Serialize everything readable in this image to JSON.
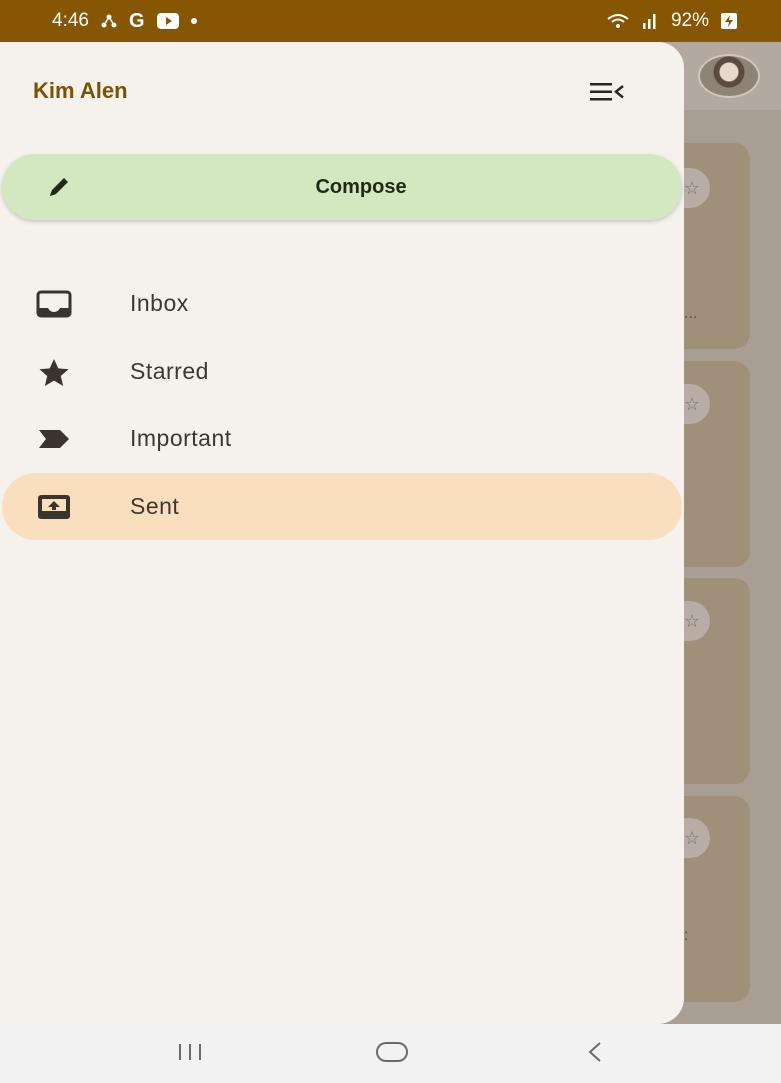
{
  "status_bar": {
    "time": "4:46",
    "battery": "92%",
    "icons": [
      "tree-icon",
      "google-icon",
      "youtube-icon",
      "dot-icon",
      "wifi-icon",
      "signal-icon",
      "battery-charging-icon"
    ],
    "google_glyph": "G"
  },
  "drawer": {
    "account_name": "Kim Alen",
    "compose_label": "Compose",
    "nav_items": [
      {
        "label": "Inbox",
        "icon": "inbox-icon",
        "active": false
      },
      {
        "label": "Starred",
        "icon": "star-icon",
        "active": false
      },
      {
        "label": "Important",
        "icon": "important-icon",
        "active": false
      },
      {
        "label": "Sent",
        "icon": "sent-icon",
        "active": true
      }
    ]
  },
  "background": {
    "dots": [
      "...",
      ":"
    ]
  },
  "colors": {
    "status_bar": "#875603",
    "accent_text": "#7c5200",
    "compose_bg": "#d3e8c0",
    "active_item_bg": "#fadfbf",
    "drawer_bg": "#f5f1ec"
  }
}
